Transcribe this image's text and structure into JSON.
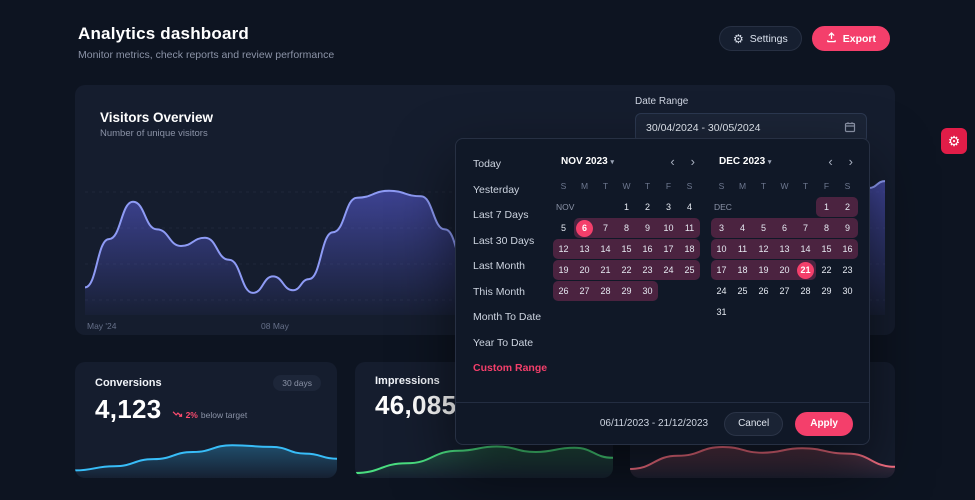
{
  "colors": {
    "bg": "#0d1421",
    "card": "#151d2e",
    "popup": "#101827",
    "border": "#273043",
    "accent": "#f43f6b",
    "muted": "#8b93a7",
    "range": "#4b2340",
    "danger": "#e11d48"
  },
  "header": {
    "title": "Analytics dashboard",
    "subtitle": "Monitor metrics, check reports and review performance",
    "settings_label": "Settings",
    "export_label": "Export"
  },
  "overview": {
    "title": "Visitors Overview",
    "subtitle": "Number of unique visitors",
    "date_range_label": "Date Range",
    "date_range_value": "30/04/2024 - 30/05/2024",
    "x_ticks": [
      "May '24",
      "08 May"
    ]
  },
  "cards": [
    {
      "title": "Conversions",
      "badge": "30 days",
      "value": "4,123",
      "trend": "2%",
      "trend_note": "below target"
    },
    {
      "title": "Impressions",
      "value": "46,085"
    },
    {}
  ],
  "datepicker": {
    "presets": [
      "Today",
      "Yesterday",
      "Last 7 Days",
      "Last 30 Days",
      "Last Month",
      "This Month",
      "Month To Date",
      "Year To Date",
      "Custom Range"
    ],
    "active_preset": "Custom Range",
    "weekdays": [
      "S",
      "M",
      "T",
      "W",
      "T",
      "F",
      "S"
    ],
    "months": [
      {
        "name": "NOV 2023",
        "tag": "NOV",
        "weeks": [
          [
            {
              "d": "NOV",
              "s": "tag"
            },
            null,
            null,
            {
              "d": "1",
              "s": "n"
            },
            {
              "d": "2",
              "s": "n"
            },
            {
              "d": "3",
              "s": "n"
            },
            {
              "d": "4",
              "s": "n"
            }
          ],
          [
            {
              "d": "5",
              "s": "n"
            },
            {
              "d": "6",
              "s": "sel"
            },
            {
              "d": "7",
              "s": "r"
            },
            {
              "d": "8",
              "s": "r"
            },
            {
              "d": "9",
              "s": "r"
            },
            {
              "d": "10",
              "s": "r"
            },
            {
              "d": "11",
              "s": "r"
            }
          ],
          [
            {
              "d": "12",
              "s": "r"
            },
            {
              "d": "13",
              "s": "r"
            },
            {
              "d": "14",
              "s": "r"
            },
            {
              "d": "15",
              "s": "r"
            },
            {
              "d": "16",
              "s": "r"
            },
            {
              "d": "17",
              "s": "r"
            },
            {
              "d": "18",
              "s": "r"
            }
          ],
          [
            {
              "d": "19",
              "s": "r"
            },
            {
              "d": "20",
              "s": "r"
            },
            {
              "d": "21",
              "s": "r"
            },
            {
              "d": "22",
              "s": "r"
            },
            {
              "d": "23",
              "s": "r"
            },
            {
              "d": "24",
              "s": "r"
            },
            {
              "d": "25",
              "s": "r"
            }
          ],
          [
            {
              "d": "26",
              "s": "r"
            },
            {
              "d": "27",
              "s": "r"
            },
            {
              "d": "28",
              "s": "r"
            },
            {
              "d": "29",
              "s": "r"
            },
            {
              "d": "30",
              "s": "r"
            },
            null,
            null
          ]
        ]
      },
      {
        "name": "DEC 2023",
        "tag": "DEC",
        "weeks": [
          [
            {
              "d": "DEC",
              "s": "tag"
            },
            null,
            null,
            null,
            null,
            {
              "d": "1",
              "s": "r"
            },
            {
              "d": "2",
              "s": "r"
            }
          ],
          [
            {
              "d": "3",
              "s": "r"
            },
            {
              "d": "4",
              "s": "r"
            },
            {
              "d": "5",
              "s": "r"
            },
            {
              "d": "6",
              "s": "r"
            },
            {
              "d": "7",
              "s": "r"
            },
            {
              "d": "8",
              "s": "r"
            },
            {
              "d": "9",
              "s": "r"
            }
          ],
          [
            {
              "d": "10",
              "s": "r"
            },
            {
              "d": "11",
              "s": "r"
            },
            {
              "d": "12",
              "s": "r"
            },
            {
              "d": "13",
              "s": "r"
            },
            {
              "d": "14",
              "s": "r"
            },
            {
              "d": "15",
              "s": "r"
            },
            {
              "d": "16",
              "s": "r"
            }
          ],
          [
            {
              "d": "17",
              "s": "r"
            },
            {
              "d": "18",
              "s": "r"
            },
            {
              "d": "19",
              "s": "r"
            },
            {
              "d": "20",
              "s": "r"
            },
            {
              "d": "21",
              "s": "sel"
            },
            {
              "d": "22",
              "s": "n"
            },
            {
              "d": "23",
              "s": "n"
            }
          ],
          [
            {
              "d": "24",
              "s": "n"
            },
            {
              "d": "25",
              "s": "n"
            },
            {
              "d": "26",
              "s": "n"
            },
            {
              "d": "27",
              "s": "n"
            },
            {
              "d": "28",
              "s": "n"
            },
            {
              "d": "29",
              "s": "n"
            },
            {
              "d": "30",
              "s": "n"
            }
          ],
          [
            {
              "d": "31",
              "s": "n"
            },
            null,
            null,
            null,
            null,
            null,
            null
          ]
        ]
      }
    ],
    "footer": {
      "range": "06/11/2023 - 21/12/2023",
      "cancel": "Cancel",
      "apply": "Apply"
    }
  },
  "chart_data": [
    {
      "key": "visitors",
      "type": "area",
      "title": "Visitors Overview",
      "xlabel": "",
      "ylabel": "Unique visitors",
      "x_ticks": [
        "May '24",
        "08 May"
      ],
      "grid": true,
      "stroke": "#8e9bf5",
      "fill_from": "rgba(99,102,241,0.55)",
      "fill_to": "rgba(99,102,241,0.04)",
      "points": [
        [
          0,
          20
        ],
        [
          3,
          55
        ],
        [
          6,
          82
        ],
        [
          9,
          62
        ],
        [
          12,
          50
        ],
        [
          15,
          56
        ],
        [
          18,
          40
        ],
        [
          21,
          16
        ],
        [
          23.5,
          28
        ],
        [
          26,
          18
        ],
        [
          28,
          26
        ],
        [
          31,
          60
        ],
        [
          34,
          85
        ],
        [
          38,
          90
        ],
        [
          42,
          86
        ],
        [
          45,
          62
        ],
        [
          48,
          30
        ],
        [
          51,
          20
        ],
        [
          55,
          38
        ],
        [
          60,
          50
        ],
        [
          65,
          36
        ],
        [
          70,
          52
        ],
        [
          75,
          44
        ],
        [
          80,
          30
        ],
        [
          85,
          26
        ],
        [
          90,
          34
        ],
        [
          95,
          55
        ],
        [
          98,
          92
        ],
        [
          100,
          97
        ]
      ]
    },
    {
      "key": "conversions",
      "type": "area",
      "title": "Conversions sparkline",
      "grid": false,
      "stroke": "#38bdf8",
      "fill_from": "rgba(56,189,248,0.30)",
      "fill_to": "rgba(56,189,248,0.02)",
      "points": [
        [
          0,
          18
        ],
        [
          15,
          28
        ],
        [
          30,
          45
        ],
        [
          45,
          62
        ],
        [
          60,
          78
        ],
        [
          75,
          74
        ],
        [
          88,
          58
        ],
        [
          100,
          46
        ]
      ]
    },
    {
      "key": "impressions",
      "type": "area",
      "title": "Impressions sparkline",
      "grid": false,
      "stroke": "#4ade80",
      "fill_from": "rgba(74,222,128,0.28)",
      "fill_to": "rgba(74,222,128,0.02)",
      "points": [
        [
          0,
          12
        ],
        [
          20,
          35
        ],
        [
          40,
          65
        ],
        [
          55,
          75
        ],
        [
          70,
          62
        ],
        [
          85,
          72
        ],
        [
          100,
          48
        ]
      ]
    },
    {
      "key": "card3",
      "type": "area",
      "title": "Third metric sparkline",
      "grid": false,
      "stroke": "#fb7185",
      "fill_from": "rgba(251,113,133,0.30)",
      "fill_to": "rgba(251,113,133,0.02)",
      "points": [
        [
          0,
          25
        ],
        [
          18,
          55
        ],
        [
          35,
          75
        ],
        [
          50,
          62
        ],
        [
          65,
          72
        ],
        [
          82,
          60
        ],
        [
          100,
          30
        ]
      ]
    }
  ]
}
